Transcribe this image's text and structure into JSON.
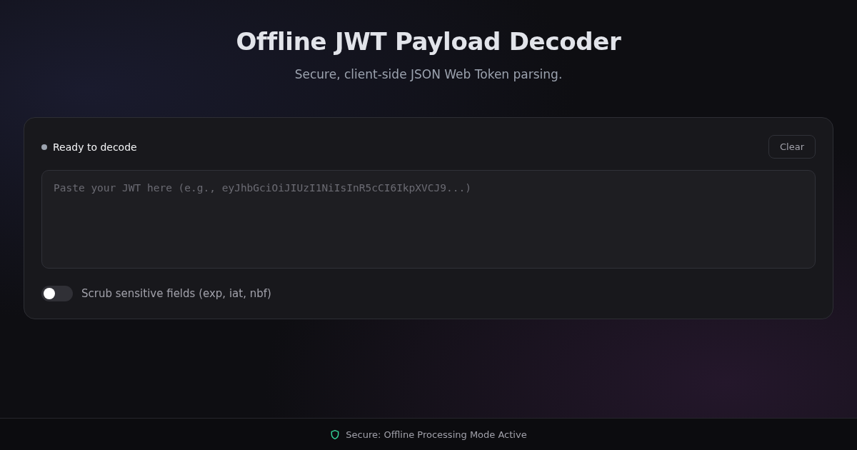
{
  "header": {
    "title": "Offline JWT Payload Decoder",
    "subtitle": "Secure, client-side JSON Web Token parsing."
  },
  "card": {
    "status": "Ready to decode",
    "clear_button": "Clear",
    "token_field": {
      "placeholder": "Paste your JWT here (e.g., eyJhbGciOiJIUzI1NiIsInR5cCI6IkpXVCJ9...)"
    },
    "scrub_toggle": {
      "label": "Scrub sensitive fields (exp, iat, nbf)",
      "on": false
    }
  },
  "footer": {
    "text": "Secure: Offline Processing Mode Active"
  }
}
